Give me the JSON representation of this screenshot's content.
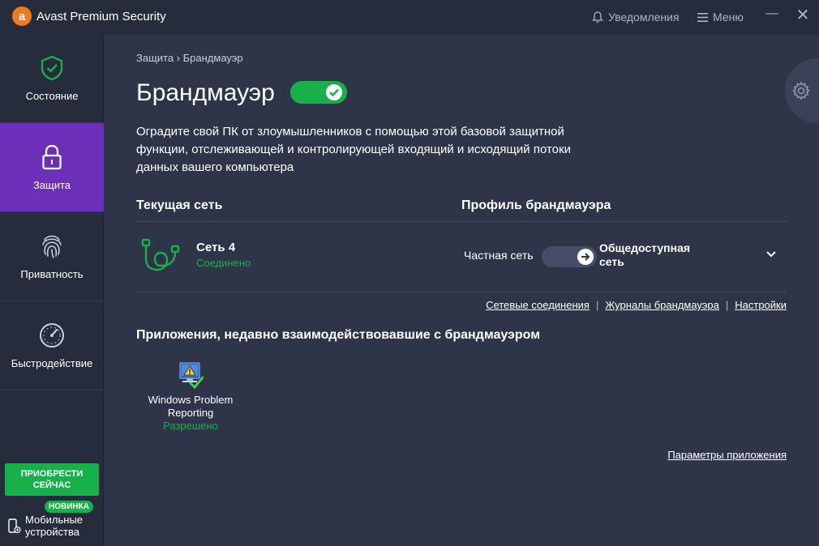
{
  "window": {
    "title": "Avast Premium Security",
    "logo_letter": "a",
    "notifications_label": "Уведомления",
    "menu_label": "Меню",
    "minimize_glyph": "—",
    "close_glyph": "✕"
  },
  "sidebar": {
    "items": [
      {
        "label": "Состояние",
        "icon": "shield-check-icon"
      },
      {
        "label": "Защита",
        "icon": "lock-icon",
        "active": true
      },
      {
        "label": "Приватность",
        "icon": "fingerprint-icon"
      },
      {
        "label": "Быстродействие",
        "icon": "speedometer-icon"
      }
    ],
    "buy_button": "ПРИОБРЕСТИ СЕЙЧАС",
    "new_badge": "НОВИНКА",
    "mobile_label": "Мобильные устройства"
  },
  "breadcrumb": "Защита › Брандмауэр",
  "page_title": "Брандмауэр",
  "firewall_enabled": true,
  "description": "Оградите свой ПК от злоумышленников с помощью этой базовой защитной функции, отслеживающей и контролирующей входящий и исходящий потоки данных вашего компьютера",
  "current_network": {
    "heading": "Текущая сеть",
    "name": "Сеть 4",
    "status": "Соединено"
  },
  "profile": {
    "heading": "Профиль брандмауэра",
    "private_label": "Частная сеть",
    "public_label": "Общедоступная сеть",
    "selected": "public"
  },
  "links": {
    "network_connections": "Сетевые соединения",
    "firewall_logs": "Журналы брандмауэра",
    "settings": "Настройки",
    "separator": "|"
  },
  "apps": {
    "heading": "Приложения, недавно взаимодействовавшие с брандмауэром",
    "items": [
      {
        "name": "Windows Problem Reporting",
        "state": "Разрешено"
      }
    ],
    "params_link": "Параметры приложения"
  },
  "colors": {
    "accent_green": "#17b04a",
    "active_purple": "#6b2fb8",
    "brand_orange": "#f07a1f",
    "background": "#2e3548",
    "sidebar": "#262c3c"
  }
}
